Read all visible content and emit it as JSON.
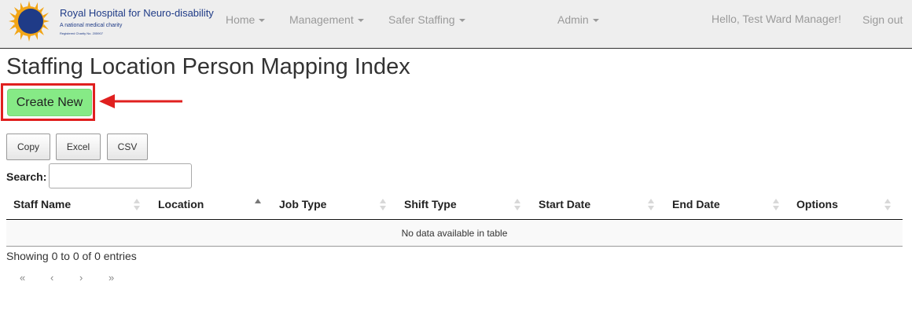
{
  "brand": {
    "name": "Royal Hospital for Neuro-disability",
    "tagline": "A national medical charity",
    "registration": "Registered Charity No. 205907"
  },
  "nav": {
    "home": "Home",
    "management": "Management",
    "safer_staffing": "Safer Staffing",
    "admin": "Admin",
    "greeting": "Hello, Test Ward Manager!",
    "sign_out": "Sign out"
  },
  "page": {
    "title": "Staffing Location Person Mapping Index",
    "create_new": "Create New"
  },
  "export_buttons": [
    "Copy",
    "Excel",
    "CSV"
  ],
  "search": {
    "label": "Search:",
    "value": "",
    "placeholder": ""
  },
  "table": {
    "columns": [
      "Staff Name",
      "Location",
      "Job Type",
      "Shift Type",
      "Start Date",
      "End Date",
      "Options"
    ],
    "sorted_column": "Location",
    "empty_message": "No data available in table",
    "info": "Showing 0 to 0 of 0 entries"
  },
  "pagination": {
    "first": "«",
    "previous": "‹",
    "next": "›",
    "last": "»"
  },
  "colors": {
    "create_button": "#86ea86",
    "highlight": "#e0201f",
    "brand_blue": "#1f3b87",
    "logo_sun": "#f2a516"
  },
  "icons": [
    "hospital-logo-icon",
    "caret-down-icon",
    "sort-icon",
    "annotation-arrow-icon"
  ]
}
